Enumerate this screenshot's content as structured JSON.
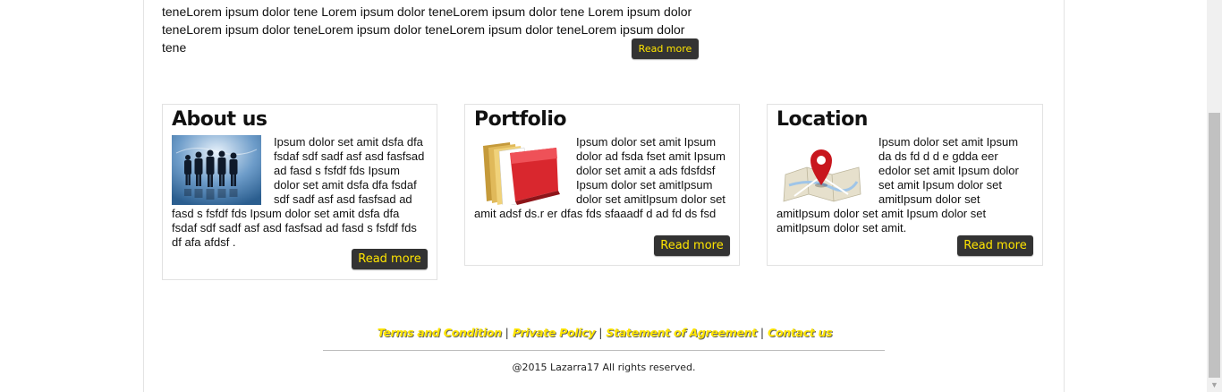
{
  "intro": {
    "text": "teneLorem ipsum dolor tene Lorem ipsum dolor teneLorem ipsum dolor tene Lorem ipsum dolor teneLorem ipsum dolor teneLorem ipsum dolor teneLorem ipsum dolor teneLorem ipsum dolor tene",
    "read_more": "Read more"
  },
  "cards": [
    {
      "title": "About us",
      "icon": "business-people-icon",
      "text": "Ipsum dolor set amit dsfa dfa fsdaf sdf sadf asf asd fasfsad ad fasd s fsfdf fds Ipsum dolor set amit dsfa dfa fsdaf sdf sadf asf asd fasfsad ad fasd s fsfdf fds Ipsum dolor set amit dsfa dfa fsdaf sdf sadf asf asd fasfsad ad fasd s fsfdf fds df afa afdsf .",
      "read_more": "Read more"
    },
    {
      "title": "Portfolio",
      "icon": "folder-icon",
      "text": "Ipsum dolor set amit Ipsum dolor ad fsda fset amit Ipsum dolor set amit a ads fdsfdsf Ipsum dolor set amitIpsum dolor set amitIpsum dolor set amit adsf ds.r er dfas fds sfaaadf d ad fd ds fsd",
      "read_more": "Read more"
    },
    {
      "title": "Location",
      "icon": "map-pin-icon",
      "text": "Ipsum dolor set amit Ipsum da ds fd d d e gdda eer edolor set amit Ipsum dolor set amit Ipsum dolor set amitIpsum dolor set amitIpsum dolor set amit Ipsum dolor set amitIpsum dolor set amit.",
      "read_more": "Read more"
    }
  ],
  "footer": {
    "links": [
      "Terms and Condition",
      "Private Policy",
      "Statement of Agreement",
      "Contact us"
    ],
    "separator": "|",
    "copyright": "@2015 Lazarra17 All rights reserved."
  },
  "colors": {
    "button_bg": "#333333",
    "button_text": "#ffe500",
    "link_yellow": "#ffe500"
  }
}
